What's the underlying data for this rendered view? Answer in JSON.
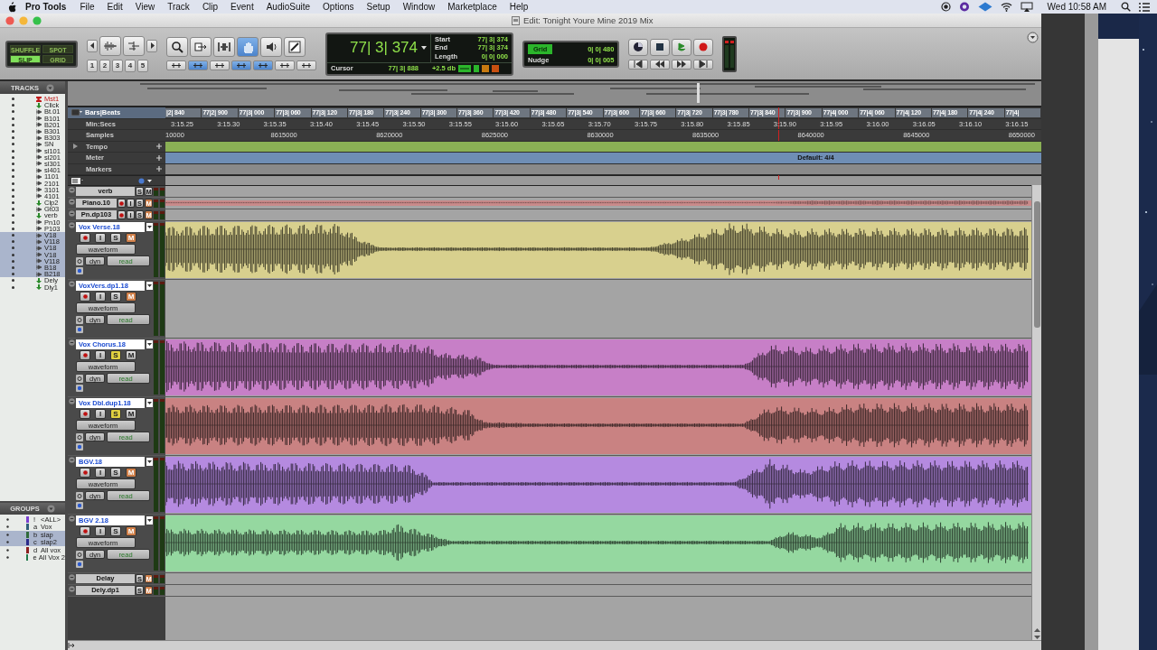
{
  "menu_bar": {
    "app": "Pro Tools",
    "items": [
      "File",
      "Edit",
      "View",
      "Track",
      "Clip",
      "Event",
      "AudioSuite",
      "Options",
      "Setup",
      "Window",
      "Marketplace",
      "Help"
    ],
    "clock": "Wed 10:58 AM"
  },
  "window": {
    "title": "Edit: Tonight Youre Mine 2019 Mix"
  },
  "toolbar": {
    "edit_modes": [
      {
        "label": "SHUFFLE",
        "selected": false
      },
      {
        "label": "SPOT",
        "selected": false
      },
      {
        "label": "SLIP",
        "selected": true
      },
      {
        "label": "GRID",
        "selected": false
      }
    ],
    "zoom_presets": [
      "1",
      "2",
      "3",
      "4",
      "5"
    ],
    "tools": [
      {
        "kind": "zoom",
        "selected": false
      },
      {
        "kind": "trim",
        "selected": false
      },
      {
        "kind": "select",
        "selected": false
      },
      {
        "kind": "grab",
        "selected": true
      },
      {
        "kind": "scrub",
        "selected": false
      },
      {
        "kind": "pencil",
        "selected": false
      }
    ],
    "toggles": [
      {
        "selected": false
      },
      {
        "selected": true
      },
      {
        "selected": false
      },
      {
        "selected": true
      },
      {
        "selected": true
      },
      {
        "selected": false
      },
      {
        "selected": false
      }
    ],
    "counter": {
      "main": "77| 3| 374",
      "fields": [
        {
          "label": "Start",
          "value": "77| 3| 374"
        },
        {
          "label": "End",
          "value": "77| 3| 374"
        },
        {
          "label": "Length",
          "value": "0| 0| 000"
        }
      ],
      "cursor_label": "Cursor",
      "cursor_value": "77| 3| 888",
      "gain": "+2.5 db"
    },
    "grid": {
      "label": "Grid",
      "value": "0| 0| 480"
    },
    "nudge": {
      "label": "Nudge",
      "value": "0| 0| 005"
    }
  },
  "tracks_panel": {
    "title": "TRACKS",
    "items": [
      {
        "name": "Mst1",
        "kind": "master",
        "selected": false
      },
      {
        "name": "Click",
        "kind": "aux",
        "selected": false
      },
      {
        "name": "Bt.01",
        "kind": "audio",
        "selected": false
      },
      {
        "name": "B101",
        "kind": "audio",
        "selected": false
      },
      {
        "name": "B201",
        "kind": "audio",
        "selected": false
      },
      {
        "name": "B301",
        "kind": "audio",
        "selected": false
      },
      {
        "name": "B303",
        "kind": "audio",
        "selected": false
      },
      {
        "name": "SN",
        "kind": "audio",
        "selected": false
      },
      {
        "name": "sl101",
        "kind": "audio",
        "selected": false
      },
      {
        "name": "sl201",
        "kind": "audio",
        "selected": false
      },
      {
        "name": "sl301",
        "kind": "audio",
        "selected": false
      },
      {
        "name": "sl401",
        "kind": "audio",
        "selected": false
      },
      {
        "name": "1101",
        "kind": "audio",
        "selected": false
      },
      {
        "name": "2101",
        "kind": "audio",
        "selected": false
      },
      {
        "name": "3101",
        "kind": "audio",
        "selected": false
      },
      {
        "name": "4101",
        "kind": "audio",
        "selected": false
      },
      {
        "name": "Clp2",
        "kind": "aux",
        "selected": false
      },
      {
        "name": "Gt03",
        "kind": "audio",
        "selected": false
      },
      {
        "name": "verb",
        "kind": "aux",
        "selected": false
      },
      {
        "name": "Pn10",
        "kind": "audio",
        "selected": false
      },
      {
        "name": "P103",
        "kind": "audio",
        "selected": false
      },
      {
        "name": "V18",
        "kind": "audio",
        "selected": true
      },
      {
        "name": "V118",
        "kind": "audio",
        "selected": true
      },
      {
        "name": "V18",
        "kind": "audio",
        "selected": true
      },
      {
        "name": "V18",
        "kind": "audio",
        "selected": true
      },
      {
        "name": "V118",
        "kind": "audio",
        "selected": true
      },
      {
        "name": "B18",
        "kind": "audio",
        "selected": true
      },
      {
        "name": "B218",
        "kind": "audio",
        "selected": true
      },
      {
        "name": "Dely",
        "kind": "aux",
        "selected": false
      },
      {
        "name": "Dly1",
        "kind": "aux",
        "selected": false
      }
    ]
  },
  "groups_panel": {
    "title": "GROUPS",
    "items": [
      {
        "id": "!",
        "name": "<ALL>",
        "color": "#7a3fd0",
        "selected": false
      },
      {
        "id": "a",
        "name": "Vox",
        "color": "#2f5f7a",
        "selected": false
      },
      {
        "id": "b",
        "name": "slap",
        "color": "#2f6a3a",
        "selected": true
      },
      {
        "id": "c",
        "name": "slap2",
        "color": "#2a2a8a",
        "selected": true
      },
      {
        "id": "d",
        "name": "All vox",
        "color": "#8a1f1f",
        "selected": false
      },
      {
        "id": "e",
        "name": "All Vox 2",
        "color": "#1f7a4a",
        "selected": false
      }
    ]
  },
  "rulers": [
    {
      "kind": "ticks",
      "label": "Bars|Beats",
      "ticks": [
        "|2| 840",
        "77|2| 900",
        "77|3| 000",
        "77|3| 060",
        "77|3| 120",
        "77|3| 180",
        "77|3| 240",
        "77|3| 300",
        "77|3| 360",
        "77|3| 420",
        "77|3| 480",
        "77|3| 540",
        "77|3| 600",
        "77|3| 660",
        "77|3| 720",
        "77|3| 780",
        "77|3| 840",
        "77|3| 900",
        "77|4| 000",
        "77|4| 060",
        "77|4| 120",
        "77|4| 180",
        "77|4| 240",
        "77|4|"
      ]
    },
    {
      "kind": "labels",
      "label": "Min:Secs",
      "ticks": [
        "3:15.25",
        "3:15.30",
        "3:15.35",
        "3:15.40",
        "3:15.45",
        "3:15.50",
        "3:15.55",
        "3:15.60",
        "3:15.65",
        "3:15.70",
        "3:15.75",
        "3:15.80",
        "3:15.85",
        "3:15.90",
        "3:15.95",
        "3:16.00",
        "3:16.05",
        "3:16.10",
        "3:16.15"
      ]
    },
    {
      "kind": "samples",
      "label": "Samples",
      "ticks": [
        "10000",
        "8615000",
        "8620000",
        "8625000",
        "8630000",
        "8635000",
        "8640000",
        "8645000",
        "8650000"
      ]
    },
    {
      "kind": "tempo",
      "label": "Tempo"
    },
    {
      "kind": "meter",
      "label": "Meter",
      "marker": "Default: 4/4"
    },
    {
      "kind": "markers",
      "label": "Markers"
    }
  ],
  "tracks": [
    {
      "name": "verb",
      "kind": "small",
      "buttons": [
        {
          "kind": "solo",
          "label": "S",
          "on": false
        },
        {
          "kind": "mute",
          "label": "M",
          "on": false
        }
      ]
    },
    {
      "name": "Piano.10",
      "kind": "small",
      "color": "#c98a8a",
      "buttons": [
        {
          "kind": "record"
        },
        {
          "kind": "input",
          "label": "I"
        },
        {
          "kind": "solo",
          "label": "S",
          "on": false
        },
        {
          "kind": "mute",
          "label": "M",
          "on": true
        }
      ]
    },
    {
      "name": "Pn.dp103",
      "kind": "small",
      "buttons": [
        {
          "kind": "record"
        },
        {
          "kind": "input",
          "label": "I"
        },
        {
          "kind": "solo",
          "label": "S",
          "on": false
        },
        {
          "kind": "mute",
          "label": "M",
          "on": true
        }
      ]
    },
    {
      "name": "Vox Verse.18",
      "kind": "large",
      "color": "#d8d08e",
      "buttons": [
        {
          "kind": "record"
        },
        {
          "kind": "input",
          "label": "I"
        },
        {
          "kind": "solo",
          "label": "S",
          "on": false
        },
        {
          "kind": "mute",
          "label": "M",
          "on": true
        }
      ],
      "view": "waveform",
      "dyn": "dyn",
      "automation": "read"
    },
    {
      "name": "VoxVers.dp1.18",
      "kind": "large",
      "buttons": [
        {
          "kind": "record"
        },
        {
          "kind": "input",
          "label": "I"
        },
        {
          "kind": "solo",
          "label": "S",
          "on": false
        },
        {
          "kind": "mute",
          "label": "M",
          "on": true
        }
      ],
      "view": "waveform",
      "dyn": "dyn",
      "automation": "read"
    },
    {
      "name": "Vox Chorus.18",
      "kind": "large",
      "color": "#c77fc7",
      "buttons": [
        {
          "kind": "record"
        },
        {
          "kind": "input",
          "label": "I"
        },
        {
          "kind": "solo",
          "label": "S",
          "on": true
        },
        {
          "kind": "mute",
          "label": "M",
          "on": false
        }
      ],
      "view": "waveform",
      "dyn": "dyn",
      "automation": "read"
    },
    {
      "name": "Vox Dbl.dup1.18",
      "kind": "large",
      "color": "#c98282",
      "buttons": [
        {
          "kind": "record"
        },
        {
          "kind": "input",
          "label": "I"
        },
        {
          "kind": "solo",
          "label": "S",
          "on": true
        },
        {
          "kind": "mute",
          "label": "M",
          "on": false
        }
      ],
      "view": "waveform",
      "dyn": "dyn",
      "automation": "read"
    },
    {
      "name": "BGV.18",
      "kind": "large",
      "color": "#b58ae0",
      "buttons": [
        {
          "kind": "record"
        },
        {
          "kind": "input",
          "label": "I"
        },
        {
          "kind": "solo",
          "label": "S",
          "on": false
        },
        {
          "kind": "mute",
          "label": "M",
          "on": true
        }
      ],
      "view": "waveform",
      "dyn": "dyn",
      "automation": "read"
    },
    {
      "name": "BGV 2.18",
      "kind": "large",
      "color": "#95d8a0",
      "buttons": [
        {
          "kind": "record"
        },
        {
          "kind": "input",
          "label": "I"
        },
        {
          "kind": "solo",
          "label": "S",
          "on": false
        },
        {
          "kind": "mute",
          "label": "M",
          "on": true
        }
      ],
      "view": "waveform",
      "dyn": "dyn",
      "automation": "read"
    },
    {
      "name": "Delay",
      "kind": "small",
      "buttons": [
        {
          "kind": "solo",
          "label": "S",
          "on": false
        },
        {
          "kind": "mute",
          "label": "M",
          "on": true
        }
      ]
    },
    {
      "name": "Dely.dp1",
      "kind": "small",
      "buttons": [
        {
          "kind": "solo",
          "label": "S",
          "on": false
        },
        {
          "kind": "mute",
          "label": "M",
          "on": true
        }
      ]
    }
  ]
}
